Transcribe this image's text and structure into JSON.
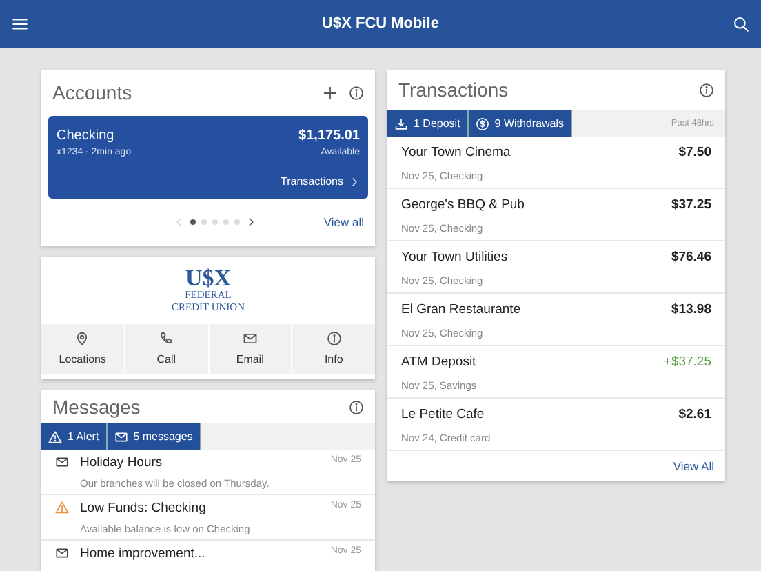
{
  "app_bar": {
    "title": "U$X FCU Mobile"
  },
  "accounts": {
    "title": "Accounts",
    "account": {
      "name": "Checking",
      "detail": "x1234 - 2min ago",
      "balance": "$1,175.01",
      "balance_label": "Available",
      "link": "Transactions"
    },
    "pager_dots": [
      {
        "selected": true
      },
      {
        "selected": false
      },
      {
        "selected": false
      },
      {
        "selected": false
      },
      {
        "selected": false
      }
    ],
    "view_all": "View all"
  },
  "logo_card": {
    "logo_mark": "U$X",
    "logo_line_1": "FEDERAL",
    "logo_line_2": "CREDIT UNION",
    "actions": [
      {
        "kind": "location",
        "label": "Locations"
      },
      {
        "kind": "call",
        "label": "Call"
      },
      {
        "kind": "email",
        "label": "Email"
      },
      {
        "kind": "info",
        "label": "Info"
      }
    ]
  },
  "messages": {
    "title": "Messages",
    "filters": [
      {
        "kind": "alert",
        "label": "1 Alert"
      },
      {
        "kind": "message",
        "label": "5 messages"
      }
    ],
    "items": [
      {
        "kind": "message",
        "title": "Holiday Hours",
        "date": "Nov 25",
        "preview": "Our branches will be closed on Thursday."
      },
      {
        "kind": "alert",
        "title": "Low Funds: Checking",
        "date": "Nov 25",
        "preview": "Available balance is low on Checking"
      },
      {
        "kind": "message",
        "title": "Home improvement...",
        "date": "Nov 25"
      }
    ]
  },
  "transactions": {
    "title": "Transactions",
    "filters": [
      {
        "kind": "deposit",
        "label": "1 Deposit"
      },
      {
        "kind": "withdrawal",
        "label": "9 Withdrawals"
      }
    ],
    "period": "Past 48hrs",
    "items": [
      {
        "kind": "withdrawal",
        "payee": "Your Town Cinema",
        "amount": "$7.50",
        "detail": "Nov 25, Checking"
      },
      {
        "kind": "withdrawal",
        "payee": "George's BBQ & Pub",
        "amount": "$37.25",
        "detail": "Nov 25, Checking"
      },
      {
        "kind": "withdrawal",
        "payee": "Your Town Utilities",
        "amount": "$76.46",
        "detail": "Nov 25, Checking"
      },
      {
        "kind": "withdrawal",
        "payee": "El Gran Restaurante",
        "amount": "$13.98",
        "detail": "Nov 25, Checking"
      },
      {
        "kind": "deposit",
        "payee": "ATM Deposit",
        "amount": "+$37.25",
        "detail": "Nov 25, Savings"
      },
      {
        "kind": "withdrawal",
        "payee": "Le Petite Cafe",
        "amount": "$2.61",
        "detail": "Nov 24, Credit card"
      }
    ],
    "view_all": "View All"
  }
}
